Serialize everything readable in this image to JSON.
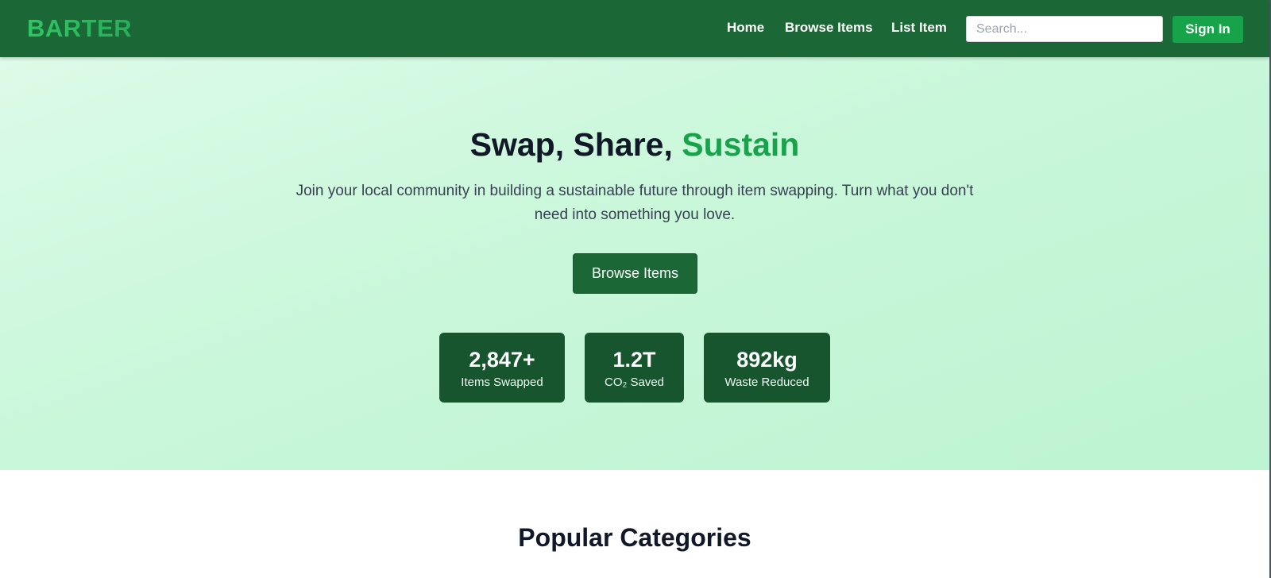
{
  "header": {
    "logo": "BARTER",
    "nav": [
      "Home",
      "Browse Items",
      "List Item"
    ],
    "search_placeholder": "Search...",
    "signin_label": "Sign In"
  },
  "hero": {
    "title_main": "Swap, Share, ",
    "title_accent": "Sustain",
    "subtitle": "Join your local community in building a sustainable future through item swapping. Turn what you don't need into something you love.",
    "cta_label": "Browse Items",
    "stats": [
      {
        "value": "2,847+",
        "label": "Items Swapped"
      },
      {
        "value": "1.2T",
        "label": "CO₂ Saved"
      },
      {
        "value": "892kg",
        "label": "Waste Reduced"
      }
    ]
  },
  "categories": {
    "title": "Popular Categories"
  },
  "colors": {
    "header_bg": "#1b6836",
    "brand_green": "#16a34a",
    "hero_bg": "#c9f7da",
    "stat_bg": "#16552e"
  }
}
